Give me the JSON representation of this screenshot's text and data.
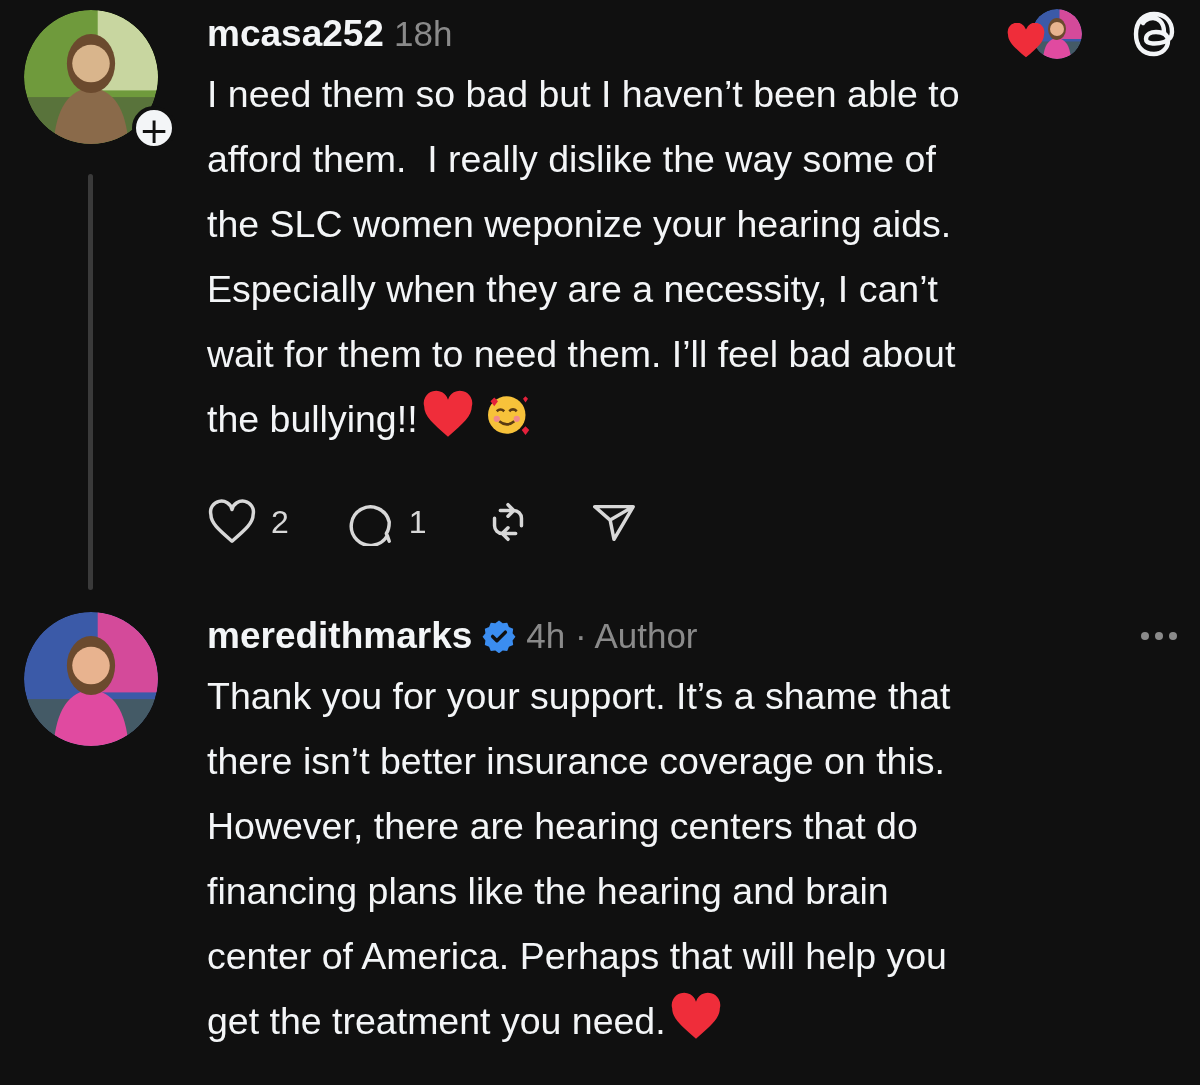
{
  "comments": [
    {
      "username": "mcasa252",
      "meta": "18h",
      "follow_badge": "+",
      "author_liked": true,
      "text": "I need them so bad but I haven’t been able to\nafford them.  I really dislike the way some of\nthe SLC women weponize your hearing aids.\nEspecially when they are a necessity, I can’t\nwait for them to need them. I’ll feel bad about\nthe bullying!!",
      "emojis": [
        {
          "kind": "heart"
        },
        {
          "kind": "smiling_hearts"
        }
      ],
      "actions": {
        "likes": "2",
        "replies": "1"
      },
      "thread_line": true
    },
    {
      "username": "meredithmarks",
      "verified": true,
      "meta": "4h · Author",
      "more_menu": true,
      "text": "Thank you for your support. It’s a shame that\nthere isn’t better insurance coverage on this.\nHowever, there are hearing centers that do\nfinancing plans like the hearing and brain\ncenter of America. Perhaps that will help you\nget the treatment you need.",
      "emojis": [
        {
          "kind": "heart"
        }
      ]
    }
  ]
}
